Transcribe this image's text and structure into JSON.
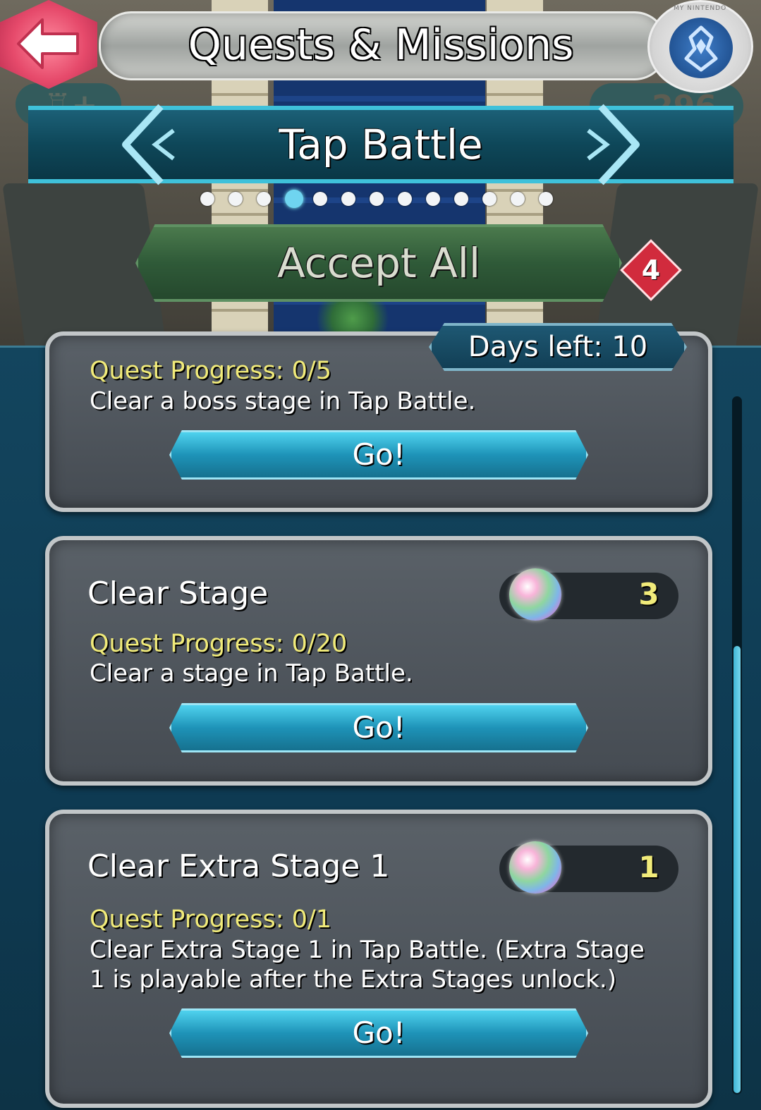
{
  "header": {
    "title": "Quests & Missions",
    "orb_count": "296",
    "badge_label": "MY NINTENDO"
  },
  "tab": {
    "title": "Tap Battle",
    "page_count": 13,
    "active_index": 3
  },
  "accept_all": {
    "label": "Accept All",
    "badge": "4"
  },
  "days_left": "Days left: 10",
  "quests": [
    {
      "title": "",
      "progress": "Quest Progress: 0/5",
      "description": "Clear a boss stage in Tap Battle.",
      "button": "Go!"
    },
    {
      "title": "Clear Stage",
      "reward": "3",
      "progress": "Quest Progress: 0/20",
      "description": "Clear a stage in Tap Battle.",
      "button": "Go!"
    },
    {
      "title": "Clear Extra Stage 1",
      "reward": "1",
      "progress": "Quest Progress: 0/1",
      "description_line1": "Clear Extra Stage 1 in Tap Battle. (Extra Stage",
      "description_line2": "1 is playable after the Extra Stages unlock.)",
      "button": "Go!"
    }
  ],
  "colors": {
    "progress_text": "#f1eb7a",
    "go_button": "#1e93b8",
    "accept_button": "#2f5a38",
    "tab_accent": "#3fc1da"
  },
  "scroll_position": 0.36
}
